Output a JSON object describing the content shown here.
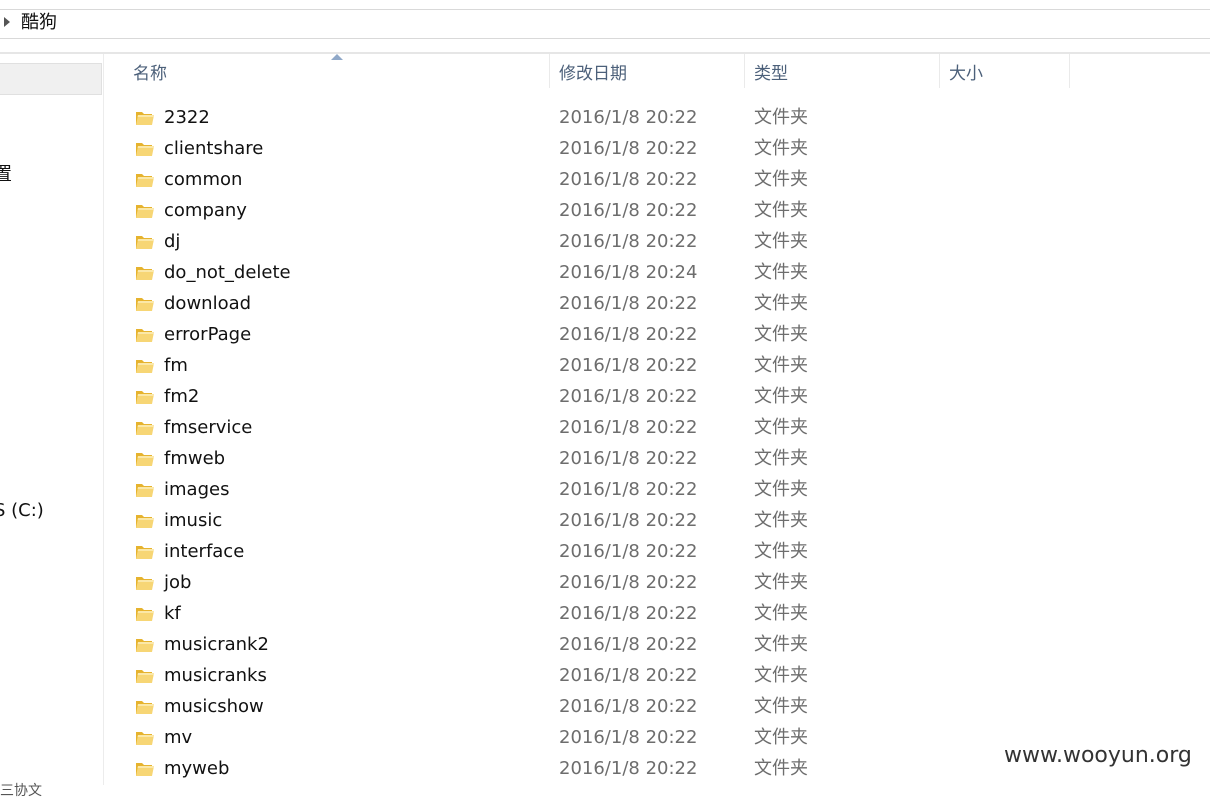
{
  "address": {
    "path": "酷狗"
  },
  "nav": {
    "partial_labels": [
      "置",
      "S (C:)"
    ],
    "partial_bottom": "三协文"
  },
  "columns": {
    "name": "名称",
    "date": "修改日期",
    "type": "类型",
    "size": "大小"
  },
  "files": [
    {
      "name": "2322",
      "date": "2016/1/8 20:22",
      "type": "文件夹"
    },
    {
      "name": "clientshare",
      "date": "2016/1/8 20:22",
      "type": "文件夹"
    },
    {
      "name": "common",
      "date": "2016/1/8 20:22",
      "type": "文件夹"
    },
    {
      "name": "company",
      "date": "2016/1/8 20:22",
      "type": "文件夹"
    },
    {
      "name": "dj",
      "date": "2016/1/8 20:22",
      "type": "文件夹"
    },
    {
      "name": "do_not_delete",
      "date": "2016/1/8 20:24",
      "type": "文件夹"
    },
    {
      "name": "download",
      "date": "2016/1/8 20:22",
      "type": "文件夹"
    },
    {
      "name": "errorPage",
      "date": "2016/1/8 20:22",
      "type": "文件夹"
    },
    {
      "name": "fm",
      "date": "2016/1/8 20:22",
      "type": "文件夹"
    },
    {
      "name": "fm2",
      "date": "2016/1/8 20:22",
      "type": "文件夹"
    },
    {
      "name": "fmservice",
      "date": "2016/1/8 20:22",
      "type": "文件夹"
    },
    {
      "name": "fmweb",
      "date": "2016/1/8 20:22",
      "type": "文件夹"
    },
    {
      "name": "images",
      "date": "2016/1/8 20:22",
      "type": "文件夹"
    },
    {
      "name": "imusic",
      "date": "2016/1/8 20:22",
      "type": "文件夹"
    },
    {
      "name": "interface",
      "date": "2016/1/8 20:22",
      "type": "文件夹"
    },
    {
      "name": "job",
      "date": "2016/1/8 20:22",
      "type": "文件夹"
    },
    {
      "name": "kf",
      "date": "2016/1/8 20:22",
      "type": "文件夹"
    },
    {
      "name": "musicrank2",
      "date": "2016/1/8 20:22",
      "type": "文件夹"
    },
    {
      "name": "musicranks",
      "date": "2016/1/8 20:22",
      "type": "文件夹"
    },
    {
      "name": "musicshow",
      "date": "2016/1/8 20:22",
      "type": "文件夹"
    },
    {
      "name": "mv",
      "date": "2016/1/8 20:22",
      "type": "文件夹"
    },
    {
      "name": "myweb",
      "date": "2016/1/8 20:22",
      "type": "文件夹"
    }
  ],
  "watermark": "www.wooyun.org",
  "colors": {
    "header_text": "#4c607a",
    "secondary_text": "#6d6d6d",
    "folder_yellow": "#f2c94c"
  },
  "icons": {
    "folder": "folder-icon",
    "expand": "chevron-right-icon",
    "sort": "sort-ascending-icon"
  }
}
